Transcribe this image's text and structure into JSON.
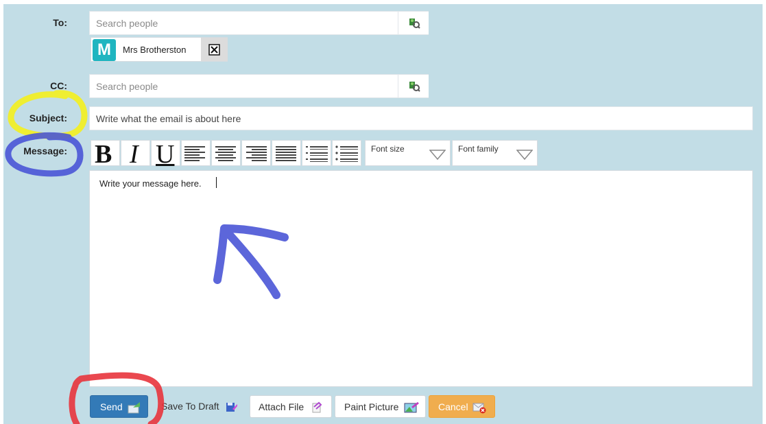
{
  "labels": {
    "to": "To:",
    "cc": "CC:",
    "subject": "Subject:",
    "message": "Message:"
  },
  "to": {
    "placeholder": "Search people",
    "recipient": {
      "initial": "M",
      "name": "Mrs Brotherston"
    }
  },
  "cc": {
    "placeholder": "Search people"
  },
  "subject": {
    "placeholder": "Write what the email is about here"
  },
  "toolbar": {
    "bold": "B",
    "italic": "I",
    "underline": "U",
    "font_size_label": "Font size",
    "font_family_label": "Font family"
  },
  "message": {
    "value": "Write your message here."
  },
  "actions": {
    "send": "Send",
    "save_draft": "Save To Draft",
    "attach": "Attach File",
    "paint": "Paint Picture",
    "cancel": "Cancel"
  },
  "colors": {
    "background": "#c2dde6",
    "send": "#337ab7",
    "cancel": "#f0ad4e",
    "avatar": "#1fb5c0",
    "annotation_blue": "#4a55d6"
  },
  "annotations": [
    "yellow circle around Subject label",
    "blue circle around Message label",
    "blue arrow pointing to message box",
    "red circle around Send button"
  ]
}
